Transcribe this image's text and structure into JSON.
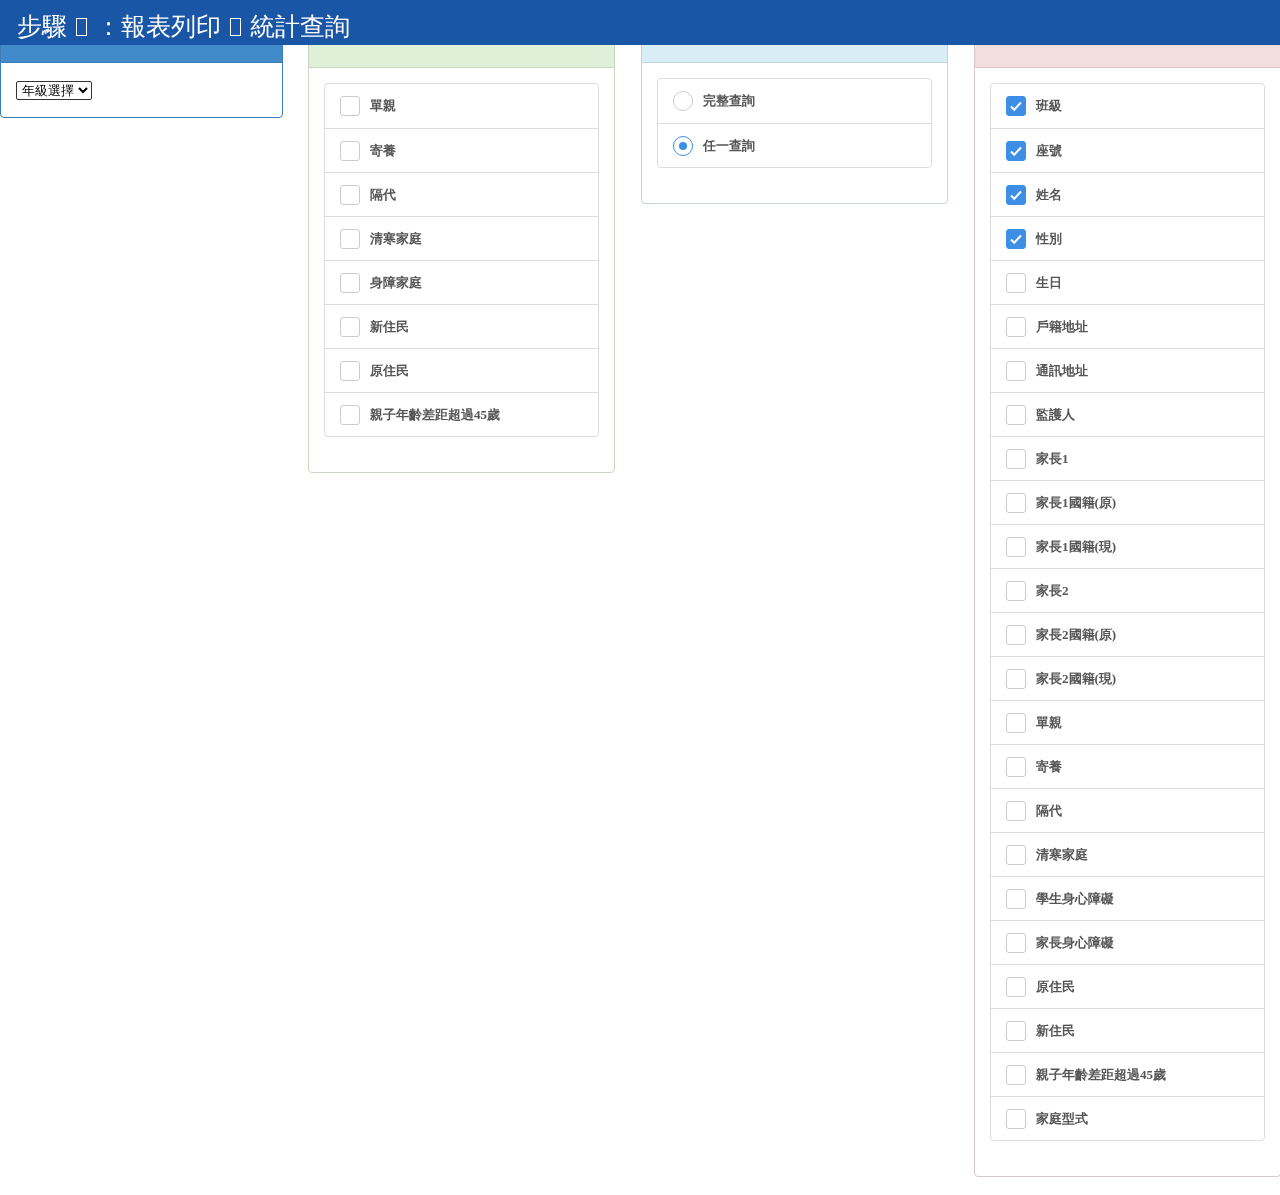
{
  "top_bar": {
    "title_parts": [
      {
        "kind": "text",
        "text": "步驟"
      },
      {
        "kind": "glyph"
      },
      {
        "kind": "text",
        "text": "：報表列印"
      },
      {
        "kind": "glyph"
      },
      {
        "kind": "text",
        "text": "統計查詢"
      }
    ]
  },
  "panels": [
    {
      "color": "#428bca",
      "kind": "select",
      "select": {
        "value": "年級選擇"
      }
    },
    {
      "color": "#dff0d8",
      "kind": "checklist",
      "items": [
        {
          "label": "單親",
          "checked": false
        },
        {
          "label": "寄養",
          "checked": false
        },
        {
          "label": "隔代",
          "checked": false
        },
        {
          "label": "清寒家庭",
          "checked": false
        },
        {
          "label": "身障家庭",
          "checked": false
        },
        {
          "label": "新住民",
          "checked": false
        },
        {
          "label": "原住民",
          "checked": false
        },
        {
          "label": "親子年齡差距超過45歲",
          "checked": false
        }
      ]
    },
    {
      "color": "#d9edf7",
      "kind": "radiolist",
      "items": [
        {
          "label": "完整查詢",
          "selected": false
        },
        {
          "label": "任一查詢",
          "selected": true
        }
      ]
    },
    {
      "color": "#f2dede",
      "kind": "checklist",
      "items": [
        {
          "label": "班級",
          "checked": true
        },
        {
          "label": "座號",
          "checked": true
        },
        {
          "label": "姓名",
          "checked": true
        },
        {
          "label": "性別",
          "checked": true
        },
        {
          "label": "生日",
          "checked": false
        },
        {
          "label": "戶籍地址",
          "checked": false
        },
        {
          "label": "通訊地址",
          "checked": false
        },
        {
          "label": "監護人",
          "checked": false
        },
        {
          "label": "家長1",
          "checked": false
        },
        {
          "label": "家長1國籍(原)",
          "checked": false
        },
        {
          "label": "家長1國籍(現)",
          "checked": false
        },
        {
          "label": "家長2",
          "checked": false
        },
        {
          "label": "家長2國籍(原)",
          "checked": false
        },
        {
          "label": "家長2國籍(現)",
          "checked": false
        },
        {
          "label": "單親",
          "checked": false
        },
        {
          "label": "寄養",
          "checked": false
        },
        {
          "label": "隔代",
          "checked": false
        },
        {
          "label": "清寒家庭",
          "checked": false
        },
        {
          "label": "學生身心障礙",
          "checked": false
        },
        {
          "label": "家長身心障礙",
          "checked": false
        },
        {
          "label": "原住民",
          "checked": false
        },
        {
          "label": "新住民",
          "checked": false
        },
        {
          "label": "親子年齡差距超過45歲",
          "checked": false
        },
        {
          "label": "家庭型式",
          "checked": false
        }
      ]
    }
  ]
}
